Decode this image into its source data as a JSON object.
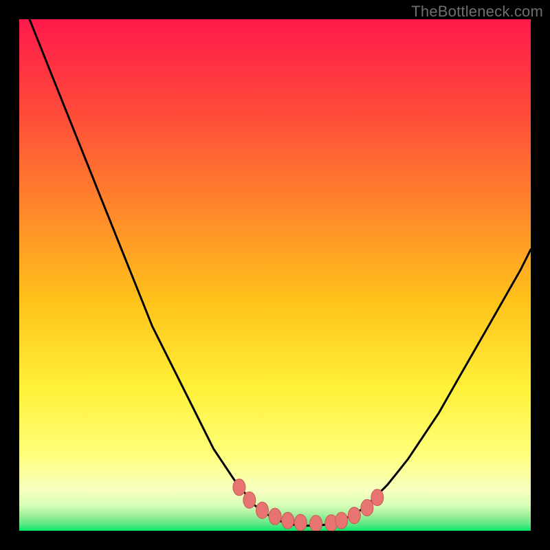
{
  "attribution": "TheBottleneck.com",
  "colors": {
    "frame": "#000000",
    "gradient_top": "#ff1a4b",
    "gradient_mid1": "#ff7a2a",
    "gradient_mid2": "#ffd31a",
    "gradient_mid3": "#ffff55",
    "gradient_mid4": "#f3ffb0",
    "gradient_bottom": "#00e868",
    "curve": "#000000",
    "marker_fill": "#e77470",
    "marker_stroke": "#c85a56"
  },
  "chart_data": {
    "type": "line",
    "title": "",
    "xlabel": "",
    "ylabel": "",
    "xlim": [
      0,
      100
    ],
    "ylim": [
      0,
      100
    ],
    "grid": false,
    "legend": false,
    "series": [
      {
        "name": "bottleneck-curve",
        "x": [
          0,
          2,
          4,
          6,
          8,
          10,
          12,
          14,
          16,
          18,
          20,
          22,
          24,
          26,
          28,
          30,
          32,
          34,
          36,
          38,
          40,
          42,
          44,
          46,
          48,
          50,
          52,
          54,
          56,
          58,
          60,
          62,
          64,
          66,
          68,
          70,
          72,
          74,
          76,
          78,
          80,
          82,
          84,
          86,
          88,
          90,
          92,
          94,
          96,
          98,
          100
        ],
        "y": [
          104,
          100,
          95,
          90,
          85,
          80,
          75,
          70,
          65,
          60,
          55,
          50,
          45,
          40,
          36,
          32,
          28,
          24,
          20,
          16,
          13,
          10,
          7.5,
          5,
          3.5,
          2.3,
          1.5,
          1.1,
          1,
          1,
          1.2,
          1.7,
          2.5,
          3.5,
          5,
          7,
          9,
          11.5,
          14,
          17,
          20,
          23,
          26.5,
          30,
          33.5,
          37,
          40.5,
          44,
          47.5,
          51,
          55
        ]
      },
      {
        "name": "valley-markers",
        "x": [
          43,
          45,
          47.5,
          50,
          52.5,
          55,
          58,
          61,
          63,
          65.5,
          68,
          70
        ],
        "y": [
          8.5,
          6,
          4,
          2.8,
          2,
          1.6,
          1.4,
          1.5,
          2,
          3,
          4.5,
          6.5
        ]
      }
    ],
    "annotations": []
  }
}
